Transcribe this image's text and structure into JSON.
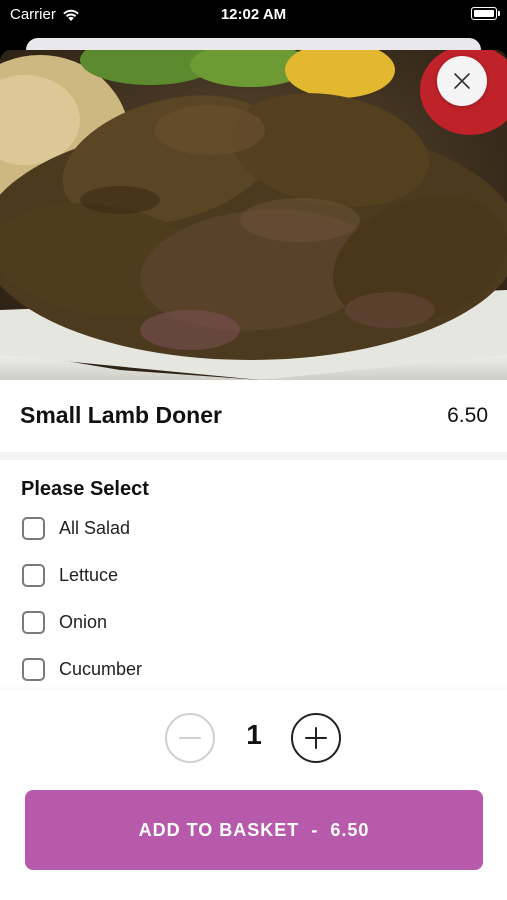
{
  "status_bar": {
    "carrier": "Carrier",
    "time": "12:02 AM"
  },
  "product": {
    "name": "Small Lamb Doner",
    "price": "6.50"
  },
  "options": {
    "heading": "Please Select",
    "items": [
      {
        "label": "All Salad",
        "checked": false
      },
      {
        "label": "Lettuce",
        "checked": false
      },
      {
        "label": "Onion",
        "checked": false
      },
      {
        "label": "Cucumber",
        "checked": false
      }
    ]
  },
  "quantity": {
    "value": "1"
  },
  "cta": {
    "label": "ADD TO BASKET",
    "separator": "-",
    "price": "6.50"
  },
  "icons": {
    "close": "close-icon",
    "minus": "minus-icon",
    "plus": "plus-icon",
    "wifi": "wifi-icon",
    "battery": "battery-icon"
  },
  "colors": {
    "accent": "#b85aac"
  }
}
